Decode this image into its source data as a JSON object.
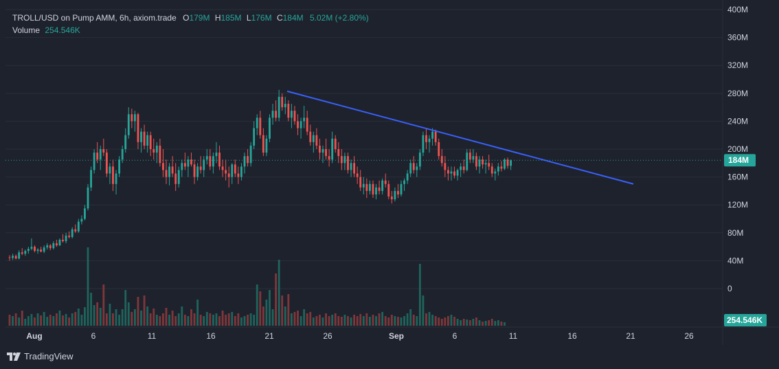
{
  "header": {
    "symbol": "TROLL/USD on Pump AMM, 6h, axiom.trade",
    "open_label": "O",
    "open_value": "179M",
    "high_label": "H",
    "high_value": "185M",
    "low_label": "L",
    "low_value": "176M",
    "close_label": "C",
    "close_value": "184M",
    "change": "5.02M (+2.80%)",
    "volume_label": "Volume",
    "volume_value": "254.546K"
  },
  "branding": {
    "name": "TradingView"
  },
  "price_tag": "184M",
  "volume_tag": "254.546K",
  "colors": {
    "up": "#26a69a",
    "down": "#ef5350",
    "trendline": "#3861fb",
    "background": "#1e222d",
    "grid": "#2a2e39"
  },
  "chart_data": {
    "type": "candlestick",
    "title": "",
    "y_axis": {
      "ticks": [
        "0",
        "40M",
        "80M",
        "120M",
        "160M",
        "200M",
        "240M",
        "280M",
        "320M",
        "360M",
        "400M"
      ],
      "unit": "M",
      "ylim": [
        0,
        400
      ]
    },
    "x_axis": {
      "ticks": [
        "Aug",
        "6",
        "11",
        "16",
        "21",
        "26",
        "Sep",
        "6",
        "11",
        "16",
        "21",
        "26"
      ],
      "bold_ticks": [
        "Aug",
        "Sep"
      ]
    },
    "x_index_range": [
      0,
      200
    ],
    "last_price": 184,
    "candles_ohlc_6h": [
      [
        45,
        48,
        40,
        44
      ],
      [
        44,
        50,
        41,
        47
      ],
      [
        47,
        49,
        42,
        43
      ],
      [
        43,
        55,
        42,
        52
      ],
      [
        52,
        58,
        48,
        50
      ],
      [
        50,
        56,
        47,
        54
      ],
      [
        54,
        60,
        50,
        57
      ],
      [
        57,
        72,
        55,
        60
      ],
      [
        60,
        62,
        52,
        54
      ],
      [
        54,
        58,
        50,
        56
      ],
      [
        56,
        60,
        52,
        53
      ],
      [
        53,
        62,
        51,
        59
      ],
      [
        59,
        65,
        56,
        62
      ],
      [
        62,
        64,
        55,
        58
      ],
      [
        58,
        68,
        56,
        65
      ],
      [
        65,
        70,
        60,
        62
      ],
      [
        62,
        72,
        61,
        70
      ],
      [
        70,
        78,
        66,
        68
      ],
      [
        68,
        80,
        65,
        76
      ],
      [
        76,
        82,
        72,
        74
      ],
      [
        74,
        88,
        72,
        85
      ],
      [
        85,
        92,
        80,
        82
      ],
      [
        82,
        100,
        80,
        96
      ],
      [
        96,
        105,
        92,
        100
      ],
      [
        100,
        120,
        98,
        115
      ],
      [
        115,
        150,
        112,
        145
      ],
      [
        145,
        175,
        140,
        170
      ],
      [
        170,
        200,
        165,
        195
      ],
      [
        195,
        210,
        180,
        185
      ],
      [
        185,
        205,
        170,
        200
      ],
      [
        200,
        215,
        190,
        195
      ],
      [
        195,
        200,
        160,
        165
      ],
      [
        165,
        180,
        150,
        175
      ],
      [
        175,
        185,
        140,
        150
      ],
      [
        150,
        170,
        135,
        165
      ],
      [
        165,
        190,
        160,
        185
      ],
      [
        185,
        205,
        180,
        200
      ],
      [
        200,
        230,
        195,
        220
      ],
      [
        220,
        260,
        215,
        250
      ],
      [
        250,
        258,
        230,
        240
      ],
      [
        240,
        255,
        225,
        250
      ],
      [
        250,
        252,
        200,
        210
      ],
      [
        210,
        230,
        195,
        225
      ],
      [
        225,
        235,
        200,
        205
      ],
      [
        205,
        225,
        195,
        220
      ],
      [
        220,
        225,
        190,
        200
      ],
      [
        200,
        215,
        185,
        195
      ],
      [
        195,
        210,
        180,
        205
      ],
      [
        205,
        215,
        175,
        180
      ],
      [
        180,
        200,
        160,
        170
      ],
      [
        170,
        185,
        150,
        160
      ],
      [
        160,
        180,
        148,
        175
      ],
      [
        175,
        190,
        160,
        165
      ],
      [
        165,
        180,
        140,
        150
      ],
      [
        150,
        175,
        145,
        170
      ],
      [
        170,
        185,
        160,
        180
      ],
      [
        180,
        195,
        170,
        175
      ],
      [
        175,
        190,
        160,
        185
      ],
      [
        185,
        195,
        175,
        178
      ],
      [
        178,
        185,
        150,
        160
      ],
      [
        160,
        180,
        155,
        175
      ],
      [
        175,
        190,
        165,
        170
      ],
      [
        170,
        190,
        160,
        185
      ],
      [
        185,
        200,
        178,
        190
      ],
      [
        190,
        200,
        170,
        175
      ],
      [
        175,
        195,
        165,
        190
      ],
      [
        190,
        210,
        180,
        195
      ],
      [
        195,
        205,
        170,
        175
      ],
      [
        175,
        185,
        160,
        170
      ],
      [
        170,
        185,
        155,
        165
      ],
      [
        165,
        175,
        145,
        160
      ],
      [
        160,
        180,
        150,
        178
      ],
      [
        178,
        185,
        160,
        165
      ],
      [
        165,
        175,
        150,
        160
      ],
      [
        160,
        180,
        155,
        175
      ],
      [
        175,
        195,
        165,
        190
      ],
      [
        190,
        200,
        175,
        180
      ],
      [
        180,
        210,
        175,
        205
      ],
      [
        205,
        240,
        200,
        230
      ],
      [
        230,
        250,
        220,
        245
      ],
      [
        245,
        255,
        215,
        220
      ],
      [
        220,
        230,
        190,
        195
      ],
      [
        195,
        220,
        190,
        215
      ],
      [
        215,
        250,
        210,
        245
      ],
      [
        245,
        265,
        235,
        255
      ],
      [
        255,
        270,
        240,
        245
      ],
      [
        245,
        285,
        240,
        275
      ],
      [
        275,
        280,
        255,
        260
      ],
      [
        260,
        275,
        250,
        265
      ],
      [
        265,
        270,
        240,
        245
      ],
      [
        245,
        265,
        230,
        255
      ],
      [
        255,
        262,
        235,
        240
      ],
      [
        240,
        250,
        220,
        230
      ],
      [
        230,
        245,
        215,
        240
      ],
      [
        240,
        262,
        230,
        245
      ],
      [
        245,
        255,
        220,
        225
      ],
      [
        225,
        235,
        205,
        210
      ],
      [
        210,
        225,
        195,
        220
      ],
      [
        220,
        230,
        200,
        205
      ],
      [
        205,
        215,
        185,
        195
      ],
      [
        195,
        205,
        180,
        200
      ],
      [
        200,
        215,
        185,
        190
      ],
      [
        190,
        200,
        175,
        185
      ],
      [
        185,
        225,
        180,
        215
      ],
      [
        215,
        220,
        195,
        200
      ],
      [
        200,
        210,
        180,
        190
      ],
      [
        190,
        200,
        170,
        180
      ],
      [
        180,
        195,
        170,
        190
      ],
      [
        190,
        195,
        165,
        170
      ],
      [
        170,
        185,
        160,
        180
      ],
      [
        180,
        190,
        160,
        165
      ],
      [
        165,
        175,
        150,
        160
      ],
      [
        160,
        170,
        140,
        145
      ],
      [
        145,
        160,
        135,
        150
      ],
      [
        150,
        158,
        130,
        140
      ],
      [
        140,
        155,
        135,
        150
      ],
      [
        150,
        155,
        130,
        135
      ],
      [
        135,
        150,
        128,
        145
      ],
      [
        145,
        155,
        135,
        140
      ],
      [
        140,
        158,
        135,
        155
      ],
      [
        155,
        165,
        145,
        150
      ],
      [
        150,
        155,
        128,
        132
      ],
      [
        132,
        140,
        122,
        128
      ],
      [
        128,
        145,
        125,
        140
      ],
      [
        140,
        150,
        130,
        135
      ],
      [
        135,
        155,
        132,
        150
      ],
      [
        150,
        158,
        140,
        155
      ],
      [
        155,
        170,
        150,
        165
      ],
      [
        165,
        185,
        160,
        180
      ],
      [
        180,
        190,
        165,
        170
      ],
      [
        170,
        180,
        160,
        175
      ],
      [
        175,
        200,
        170,
        195
      ],
      [
        195,
        225,
        190,
        220
      ],
      [
        220,
        230,
        200,
        210
      ],
      [
        210,
        220,
        195,
        215
      ],
      [
        215,
        230,
        205,
        225
      ],
      [
        225,
        228,
        205,
        210
      ],
      [
        210,
        215,
        185,
        190
      ],
      [
        190,
        200,
        175,
        180
      ],
      [
        180,
        190,
        160,
        170
      ],
      [
        170,
        175,
        155,
        165
      ],
      [
        165,
        175,
        155,
        168
      ],
      [
        168,
        175,
        158,
        162
      ],
      [
        162,
        172,
        155,
        170
      ],
      [
        170,
        180,
        160,
        175
      ],
      [
        175,
        185,
        165,
        170
      ],
      [
        170,
        200,
        168,
        195
      ],
      [
        195,
        200,
        180,
        185
      ],
      [
        185,
        200,
        180,
        190
      ],
      [
        190,
        195,
        170,
        175
      ],
      [
        175,
        190,
        165,
        185
      ],
      [
        185,
        190,
        172,
        178
      ],
      [
        178,
        185,
        165,
        180
      ],
      [
        180,
        192,
        170,
        175
      ],
      [
        175,
        180,
        160,
        165
      ],
      [
        165,
        172,
        155,
        168
      ],
      [
        168,
        180,
        162,
        175
      ],
      [
        175,
        183,
        168,
        172
      ],
      [
        172,
        187,
        170,
        185
      ],
      [
        185,
        188,
        172,
        176
      ],
      [
        176,
        185,
        170,
        184
      ]
    ],
    "volume_k": [
      800,
      700,
      900,
      600,
      1100,
      500,
      700,
      850,
      600,
      900,
      750,
      1000,
      650,
      800,
      700,
      900,
      1100,
      750,
      850,
      600,
      900,
      1000,
      1250,
      800,
      1350,
      5700,
      2400,
      1500,
      1700,
      1300,
      3000,
      900,
      1600,
      900,
      1200,
      800,
      1200,
      2600,
      1700,
      1000,
      1200,
      2100,
      1100,
      2200,
      1400,
      900,
      1250,
      800,
      700,
      900,
      1300,
      800,
      1100,
      700,
      900,
      1400,
      800,
      700,
      1200,
      900,
      1900,
      800,
      700,
      1000,
      900,
      800,
      900,
      700,
      1100,
      800,
      900,
      1000,
      700,
      900,
      600,
      700,
      800,
      900,
      800,
      3000,
      2500,
      1400,
      1900,
      2600,
      1200,
      3800,
      4800,
      2200,
      1400,
      2300,
      900,
      1000,
      1100,
      700,
      1200,
      900,
      1000,
      600,
      700,
      800,
      600,
      900,
      700,
      800,
      900,
      700,
      650,
      800,
      700,
      600,
      800,
      700,
      850,
      700,
      900,
      650,
      800,
      700,
      900,
      1000,
      700,
      600,
      800,
      700,
      650,
      600,
      700,
      900,
      1200,
      800,
      700,
      4500,
      2200,
      900,
      1000,
      800,
      700,
      600,
      500,
      600,
      700,
      800,
      650,
      500,
      400,
      500,
      450,
      400,
      500,
      600,
      400,
      300,
      350,
      400,
      500,
      350,
      400,
      300,
      250
    ]
  }
}
